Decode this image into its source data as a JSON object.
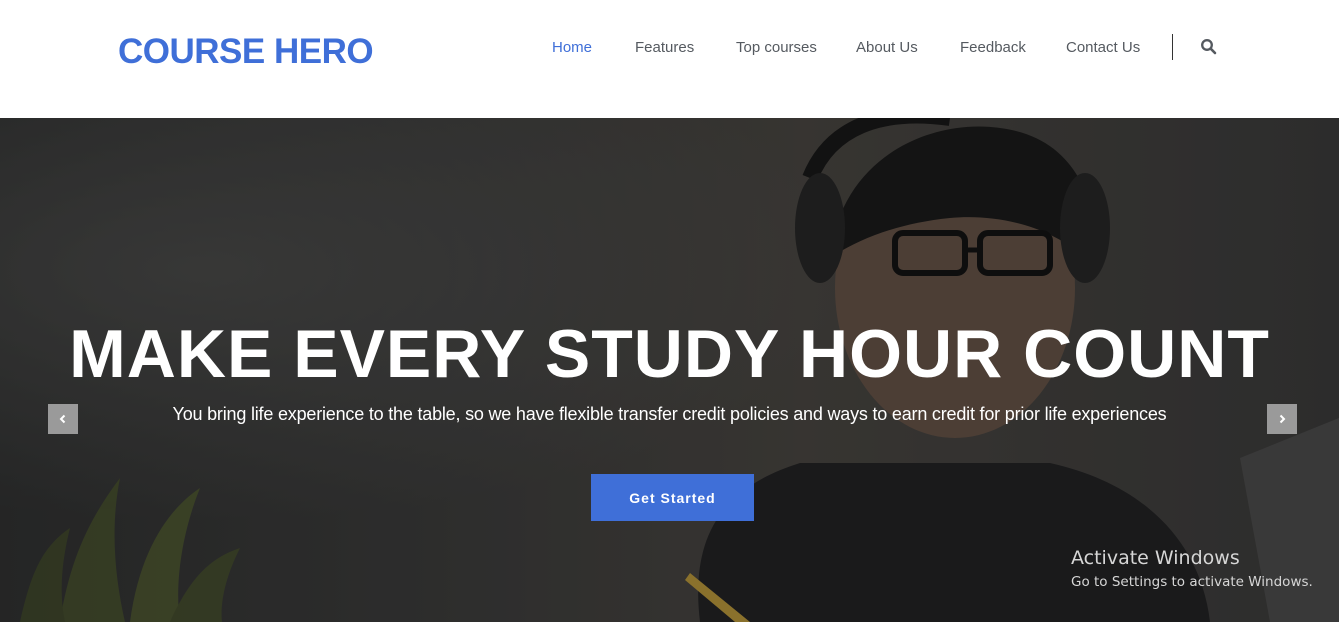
{
  "brand": {
    "name": "COURSE HERO",
    "color": "#3f6fd8"
  },
  "nav": {
    "items": [
      {
        "label": "Home",
        "active": true
      },
      {
        "label": "Features",
        "active": false
      },
      {
        "label": "Top courses",
        "active": false
      },
      {
        "label": "About Us",
        "active": false
      },
      {
        "label": "Feedback",
        "active": false
      },
      {
        "label": "Contact Us",
        "active": false
      }
    ],
    "search_icon": "search-icon"
  },
  "hero": {
    "title": "MAKE EVERY STUDY HOUR COUNT",
    "subtitle": "You bring life experience to the table, so we have flexible transfer credit policies and ways to earn credit for prior life experiences",
    "cta_label": "Get Started",
    "prev_icon": "chevron-left-icon",
    "next_icon": "chevron-right-icon",
    "background": "student-with-headphones-photo"
  },
  "watermark": {
    "title": "Activate Windows",
    "subtitle": "Go to Settings to activate Windows."
  },
  "colors": {
    "accent": "#3f6fd8",
    "nav_text": "#555a60",
    "arrow_bg": "#9a9a9a"
  }
}
